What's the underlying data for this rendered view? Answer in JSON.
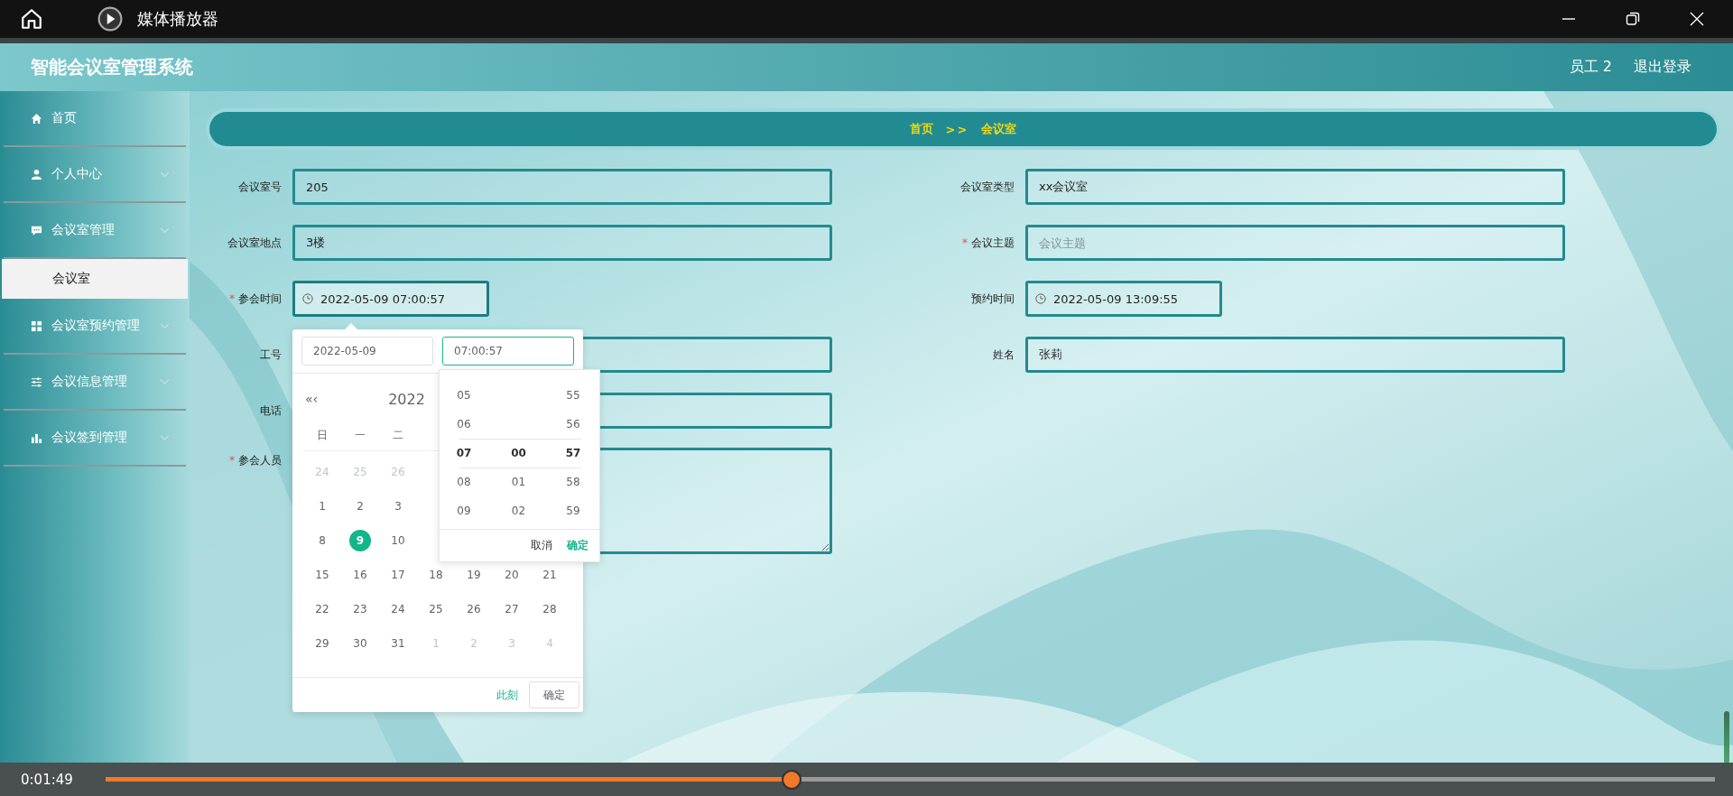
{
  "window": {
    "title": "媒体播放器"
  },
  "app": {
    "title": "智能会议室管理系统",
    "user": "员工 2",
    "logout": "退出登录"
  },
  "sidebar": {
    "items": [
      {
        "kind": "item",
        "label": "首页",
        "selected": false
      },
      {
        "kind": "group",
        "label": "个人中心",
        "selected": false
      },
      {
        "kind": "group",
        "label": "会议室管理",
        "selected": false
      },
      {
        "kind": "sub",
        "label": "会议室",
        "selected": true
      },
      {
        "kind": "group",
        "label": "会议室预约管理",
        "selected": false
      },
      {
        "kind": "group",
        "label": "会议信息管理",
        "selected": false
      },
      {
        "kind": "group",
        "label": "会议签到管理",
        "selected": false
      }
    ]
  },
  "breadcrumb": {
    "items": [
      "首页",
      "会议室"
    ],
    "separator": ">>"
  },
  "form": {
    "required_mark": "*",
    "left": [
      {
        "kind": "text",
        "label": "会议室号",
        "required": false,
        "value": "205"
      },
      {
        "kind": "text",
        "label": "会议室地点",
        "required": false,
        "value": "3楼"
      },
      {
        "kind": "date",
        "label": "参会时间",
        "required": true,
        "value": "2022-05-09 07:00:57",
        "open": true
      },
      {
        "kind": "text",
        "label": "工号",
        "required": false
      },
      {
        "kind": "text",
        "label": "电话",
        "required": false
      },
      {
        "kind": "textarea",
        "label": "参会人员",
        "required": true
      }
    ],
    "right": [
      {
        "kind": "text",
        "label": "会议室类型",
        "required": false,
        "value": "xx会议室"
      },
      {
        "kind": "text",
        "label": "会议主题",
        "required": true,
        "placeholder": "会议主题"
      },
      {
        "kind": "date",
        "label": "预约时间",
        "required": false,
        "value": "2022-05-09 13:09:55",
        "open": false
      },
      {
        "kind": "text",
        "label": "姓名",
        "required": false,
        "value": "张莉"
      }
    ]
  },
  "date_picker": {
    "date_value": "2022-05-09",
    "time_value": "07:00:57",
    "nav": "«‹",
    "year": "2022",
    "weekdays": [
      "日",
      "一",
      "二"
    ],
    "weeks": [
      [
        {
          "text": "24",
          "muted": true,
          "selected": false
        },
        {
          "text": "25",
          "muted": true,
          "selected": false
        },
        {
          "text": "26",
          "muted": true,
          "selected": false
        }
      ],
      [
        {
          "text": "1",
          "muted": false,
          "selected": false
        },
        {
          "text": "2",
          "muted": false,
          "selected": false
        },
        {
          "text": "3",
          "muted": false,
          "selected": false
        }
      ],
      [
        {
          "text": "8",
          "muted": false,
          "selected": false
        },
        {
          "text": "9",
          "muted": false,
          "selected": true
        },
        {
          "text": "10",
          "muted": false,
          "selected": false
        }
      ],
      [
        {
          "text": "15",
          "muted": false,
          "selected": false
        },
        {
          "text": "16",
          "muted": false,
          "selected": false
        },
        {
          "text": "17",
          "muted": false,
          "selected": false
        },
        {
          "text": "18",
          "muted": false,
          "selected": false
        },
        {
          "text": "19",
          "muted": false,
          "selected": false
        },
        {
          "text": "20",
          "muted": false,
          "selected": false
        },
        {
          "text": "21",
          "muted": false,
          "selected": false
        }
      ],
      [
        {
          "text": "22",
          "muted": false,
          "selected": false
        },
        {
          "text": "23",
          "muted": false,
          "selected": false
        },
        {
          "text": "24",
          "muted": false,
          "selected": false
        },
        {
          "text": "25",
          "muted": false,
          "selected": false
        },
        {
          "text": "26",
          "muted": false,
          "selected": false
        },
        {
          "text": "27",
          "muted": false,
          "selected": false
        },
        {
          "text": "28",
          "muted": false,
          "selected": false
        }
      ],
      [
        {
          "text": "29",
          "muted": false,
          "selected": false
        },
        {
          "text": "30",
          "muted": false,
          "selected": false
        },
        {
          "text": "31",
          "muted": false,
          "selected": false
        },
        {
          "text": "1",
          "muted": true,
          "selected": false
        },
        {
          "text": "2",
          "muted": true,
          "selected": false
        },
        {
          "text": "3",
          "muted": true,
          "selected": false
        },
        {
          "text": "4",
          "muted": true,
          "selected": false
        }
      ]
    ],
    "now_button": "此刻",
    "ok_button": "确定",
    "time_panel": {
      "columns": [
        [
          {
            "text": "05",
            "selected": false
          },
          {
            "text": "06",
            "selected": false
          },
          {
            "text": "07",
            "selected": true
          },
          {
            "text": "08",
            "selected": false
          },
          {
            "text": "09",
            "selected": false
          }
        ],
        [
          {
            "text": "00",
            "selected": true
          },
          {
            "text": "01",
            "selected": false
          },
          {
            "text": "02",
            "selected": false
          }
        ],
        [
          {
            "text": "55",
            "selected": false
          },
          {
            "text": "56",
            "selected": false
          },
          {
            "text": "57",
            "selected": true
          },
          {
            "text": "58",
            "selected": false
          },
          {
            "text": "59",
            "selected": false
          }
        ]
      ],
      "cancel": "取消",
      "ok": "确定"
    }
  },
  "player": {
    "time": "0:01:49",
    "level": 0.426
  }
}
